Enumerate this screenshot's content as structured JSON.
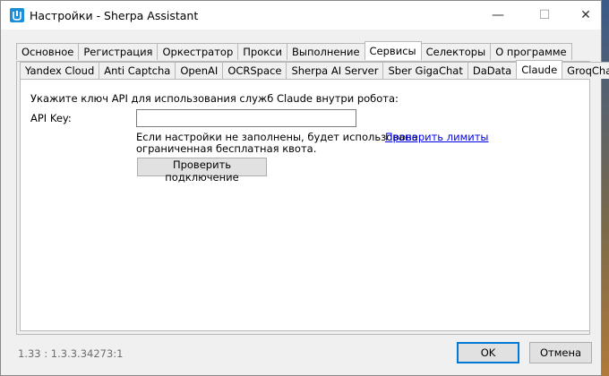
{
  "window": {
    "title": "Настройки - Sherpa Assistant",
    "minimize_glyph": "—",
    "maximize_glyph": "☐",
    "close_glyph": "✕"
  },
  "main_tabs": [
    {
      "label": "Основное",
      "active": false
    },
    {
      "label": "Регистрация",
      "active": false
    },
    {
      "label": "Оркестратор",
      "active": false
    },
    {
      "label": "Прокси",
      "active": false
    },
    {
      "label": "Выполнение",
      "active": false
    },
    {
      "label": "Сервисы",
      "active": true
    },
    {
      "label": "Селекторы",
      "active": false
    },
    {
      "label": "О программе",
      "active": false
    }
  ],
  "service_tabs": [
    {
      "label": "Yandex Cloud",
      "active": false
    },
    {
      "label": "Anti Captcha",
      "active": false
    },
    {
      "label": "OpenAI",
      "active": false
    },
    {
      "label": "OCRSpace",
      "active": false
    },
    {
      "label": "Sherpa AI Server",
      "active": false
    },
    {
      "label": "Sber GigaChat",
      "active": false
    },
    {
      "label": "DaData",
      "active": false
    },
    {
      "label": "Claude",
      "active": true
    },
    {
      "label": "GroqChat",
      "active": false
    }
  ],
  "claude": {
    "instruction": "Укажите ключ API для использования служб Claude внутри робота:",
    "api_key_label": "API Key:",
    "api_key_value": "",
    "note_line1": "Если настройки не заполнены, будет использована",
    "note_line2": "ограниченная бесплатная квота.",
    "check_limits_link": "Проверить лимиты",
    "test_connection_button": "Проверить подключение"
  },
  "footer": {
    "version": "1.33 : 1.3.3.34273:1",
    "ok_button": "OK",
    "cancel_button": "Отмена"
  }
}
